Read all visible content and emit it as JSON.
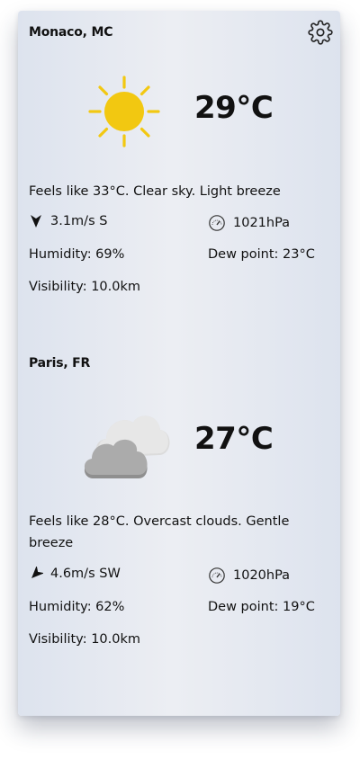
{
  "locations": [
    {
      "city": "Monaco, MC",
      "temperature": "29°C",
      "condition_icon": "sun-icon",
      "description": "Feels like 33°C. Clear sky. Light breeze",
      "wind": "3.1m/s S",
      "pressure": "1021hPa",
      "humidity": "Humidity: 69%",
      "dew_point": "Dew point: 23°C",
      "visibility": "Visibility: 10.0km"
    },
    {
      "city": "Paris, FR",
      "temperature": "27°C",
      "condition_icon": "clouds-icon",
      "description": "Feels like 28°C. Overcast clouds. Gentle breeze",
      "wind": "4.6m/s SW",
      "pressure": "1020hPa",
      "humidity": "Humidity: 62%",
      "dew_point": "Dew point: 19°C",
      "visibility": "Visibility: 10.0km"
    }
  ],
  "colors": {
    "sun": "#f2c811",
    "cloud_light": "#e2e2e2",
    "cloud_dark": "#a9a9a9"
  },
  "toolbar": {
    "settings_icon": "gear-icon"
  }
}
